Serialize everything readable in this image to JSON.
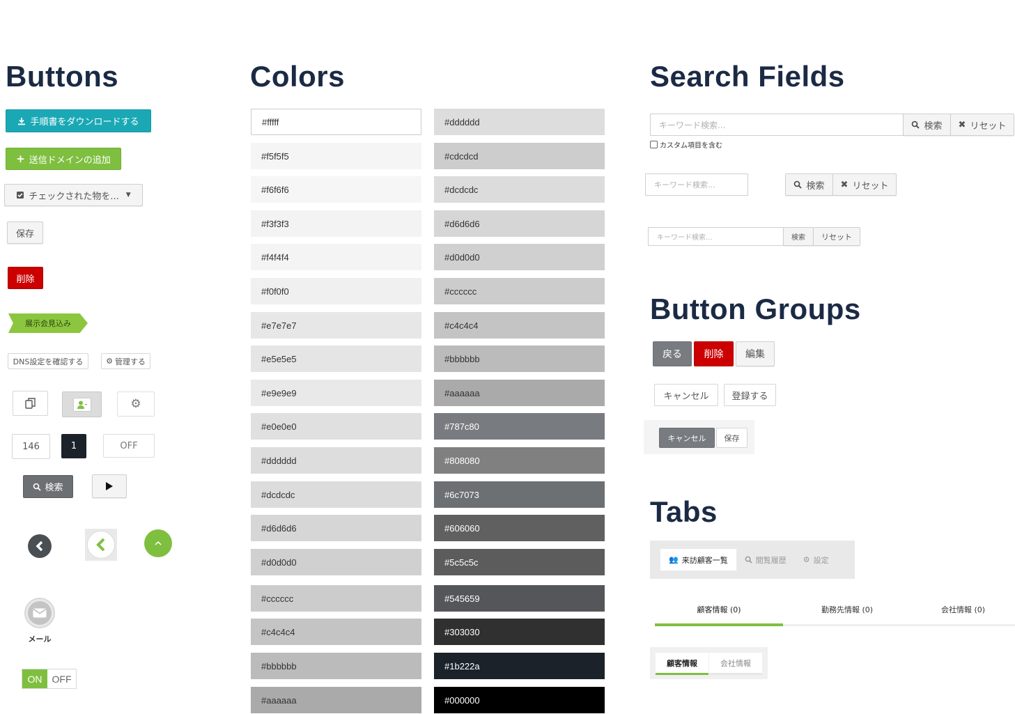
{
  "headings": {
    "buttons": "Buttons",
    "colors": "Colors",
    "search_fields": "Search Fields",
    "button_groups": "Button Groups",
    "tabs": "Tabs"
  },
  "buttons": {
    "download": "手順書をダウンロードする",
    "add_domain": "送信ドメインの追加",
    "checked_dropdown": "チェックされた物を...",
    "save": "保存",
    "delete": "削除",
    "exhibition": "展示会見込み",
    "dns_check": "DNS設定を確認する",
    "manage": "管理する",
    "count_value": "146",
    "dark_number": "1",
    "off_toggle": "OFF",
    "search": "検索",
    "mail_label": "メール",
    "switch_on": "ON",
    "switch_off": "OFF"
  },
  "colors": {
    "left": [
      {
        "label": "#fffff",
        "hex": "#ffffff"
      },
      {
        "label": "#f5f5f5",
        "hex": "#f5f5f5"
      },
      {
        "label": "#f6f6f6",
        "hex": "#f6f6f6"
      },
      {
        "label": "#f3f3f3",
        "hex": "#f3f3f3"
      },
      {
        "label": "#f4f4f4",
        "hex": "#f4f4f4"
      },
      {
        "label": "#f0f0f0",
        "hex": "#f0f0f0"
      },
      {
        "label": "#e7e7e7",
        "hex": "#e7e7e7"
      },
      {
        "label": "#e5e5e5",
        "hex": "#e5e5e5"
      },
      {
        "label": "#e9e9e9",
        "hex": "#e9e9e9"
      },
      {
        "label": "#e0e0e0",
        "hex": "#e0e0e0"
      },
      {
        "label": "#dddddd",
        "hex": "#dddddd"
      },
      {
        "label": "#dcdcdc",
        "hex": "#dcdcdc"
      },
      {
        "label": "#d6d6d6",
        "hex": "#d6d6d6"
      },
      {
        "label": "#d0d0d0",
        "hex": "#d0d0d0"
      },
      {
        "label": "#cccccc",
        "hex": "#cccccc"
      },
      {
        "label": "#c4c4c4",
        "hex": "#c4c4c4"
      },
      {
        "label": "#bbbbbb",
        "hex": "#bbbbbb"
      },
      {
        "label": "#aaaaaa",
        "hex": "#aaaaaa"
      }
    ],
    "right": [
      {
        "label": "#dddddd",
        "hex": "#dddddd"
      },
      {
        "label": "#cdcdcd",
        "hex": "#cdcdcd"
      },
      {
        "label": "#dcdcdc",
        "hex": "#dcdcdc"
      },
      {
        "label": "#d6d6d6",
        "hex": "#d6d6d6"
      },
      {
        "label": "#d0d0d0",
        "hex": "#d0d0d0"
      },
      {
        "label": "#cccccc",
        "hex": "#cccccc"
      },
      {
        "label": "#c4c4c4",
        "hex": "#c4c4c4"
      },
      {
        "label": "#bbbbbb",
        "hex": "#bbbbbb"
      },
      {
        "label": "#aaaaaa",
        "hex": "#aaaaaa"
      },
      {
        "label": "#787c80",
        "hex": "#787c80"
      },
      {
        "label": "#808080",
        "hex": "#808080"
      },
      {
        "label": "#6c7073",
        "hex": "#6c7073"
      },
      {
        "label": "#606060",
        "hex": "#606060"
      },
      {
        "label": "#5c5c5c",
        "hex": "#5c5c5c"
      },
      {
        "label": "#545659",
        "hex": "#545659"
      },
      {
        "label": "#303030",
        "hex": "#303030"
      },
      {
        "label": "#1b222a",
        "hex": "#1b222a"
      },
      {
        "label": "#000000",
        "hex": "#000000"
      }
    ]
  },
  "search_fields": {
    "placeholder": "キーワード検索...",
    "search": "検索",
    "reset": "リセット",
    "custom_checkbox": "カスタム項目を含む"
  },
  "button_groups": {
    "back": "戻る",
    "delete": "削除",
    "edit": "編集",
    "cancel": "キャンセル",
    "register": "登録する",
    "cancel_small": "キャンセル",
    "save_small": "保存"
  },
  "tabs": {
    "visitors": "来訪顧客一覧",
    "history": "閲覧履歴",
    "settings": "設定",
    "customer_info": "顧客情報 (0)",
    "workplace_info": "勤務先情報 (0)",
    "company_info": "会社情報 (0)",
    "small_customer": "顧客情報",
    "small_company": "会社情報"
  },
  "accent_colors": {
    "teal": "#1aa8b5",
    "green": "#7fbf3f",
    "red": "#cc0000",
    "heading": "#1b2a44"
  }
}
